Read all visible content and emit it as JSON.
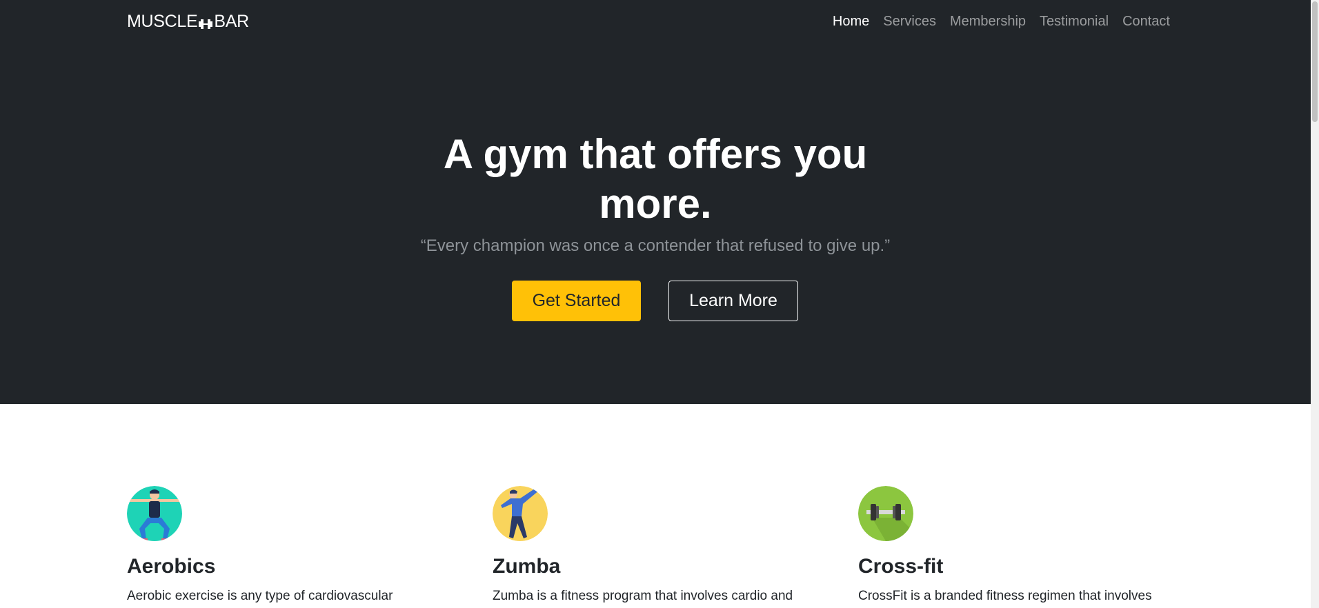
{
  "brand": {
    "left": "MUSCLE",
    "right": "BAR",
    "icon": "dumbbell-icon"
  },
  "nav": {
    "items": [
      {
        "label": "Home",
        "active": true
      },
      {
        "label": "Services",
        "active": false
      },
      {
        "label": "Membership",
        "active": false
      },
      {
        "label": "Testimonial",
        "active": false
      },
      {
        "label": "Contact",
        "active": false
      }
    ]
  },
  "hero": {
    "title_line1": "A gym that offers you",
    "title_line2": "more.",
    "quote": "“Every champion was once a contender that refused to give up.”",
    "primary_button": "Get Started",
    "secondary_button": "Learn More"
  },
  "services": [
    {
      "title": "Aerobics",
      "text": "Aerobic exercise is any type of cardiovascular",
      "icon": "aerobics-person-icon"
    },
    {
      "title": "Zumba",
      "text": "Zumba is a fitness program that involves cardio and",
      "icon": "zumba-dancer-icon"
    },
    {
      "title": "Cross-fit",
      "text": "CrossFit is a branded fitness regimen that involves",
      "icon": "barbell-icon"
    }
  ],
  "colors": {
    "dark": "#212529",
    "accent": "#ffc107",
    "muted": "#8e9398"
  }
}
